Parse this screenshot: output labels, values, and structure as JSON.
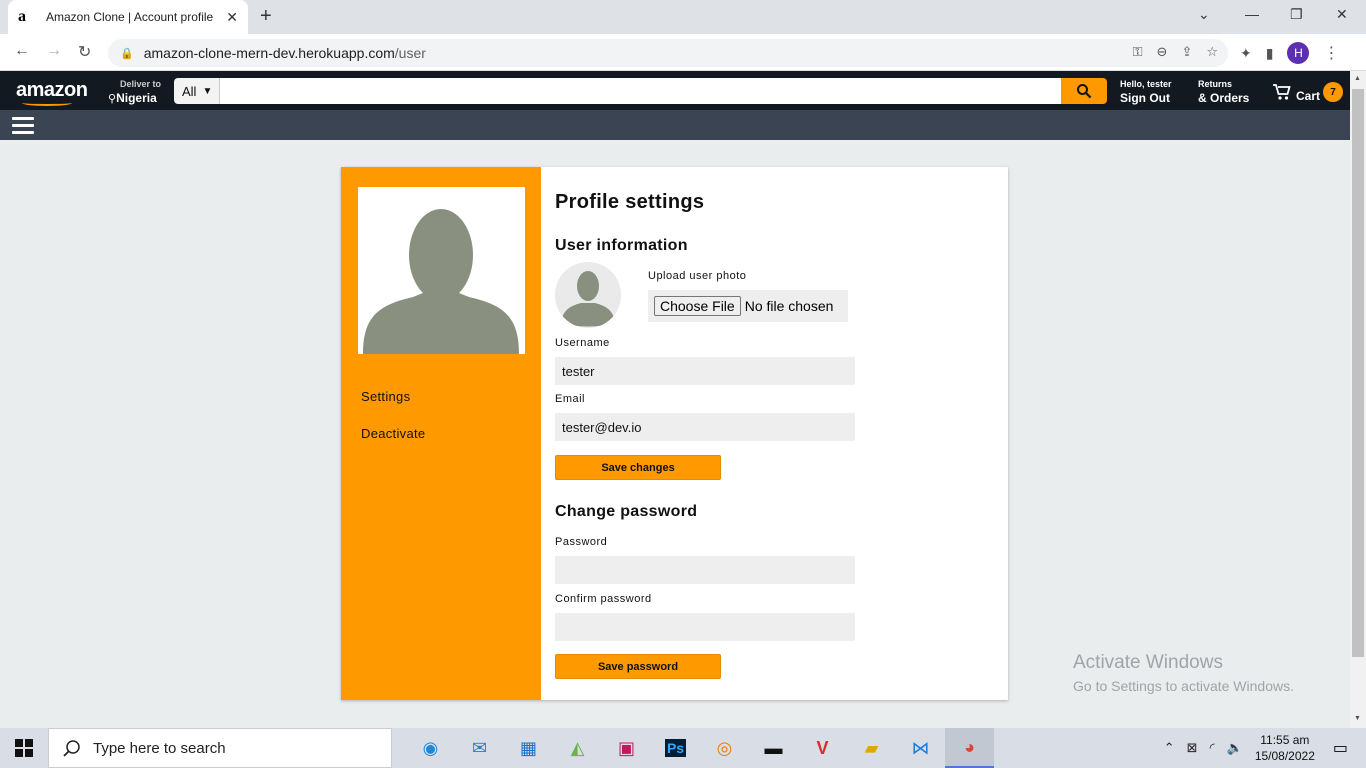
{
  "browser": {
    "tab_title": "Amazon Clone | Account profile",
    "favicon": "a",
    "url_domain": "amazon-clone-mern-dev.herokuapp.com",
    "url_path": "/user",
    "profile_initial": "H"
  },
  "header": {
    "logo": "amazon",
    "deliver_small": "Deliver to",
    "deliver_location": "Nigeria",
    "search_category": "All",
    "search_placeholder": "",
    "greeting": "Hello, tester",
    "sign_out": "Sign Out",
    "returns_small": "Returns",
    "orders": "& Orders",
    "cart_label": "Cart",
    "cart_count": "7"
  },
  "sidebar": {
    "items": [
      {
        "label": "Settings"
      },
      {
        "label": "Deactivate"
      }
    ]
  },
  "profile": {
    "title": "Profile settings",
    "user_info_heading": "User information",
    "upload_label": "Upload user photo",
    "choose_file": "Choose File",
    "no_file": "No file chosen",
    "username_label": "Username",
    "username_value": "tester",
    "email_label": "Email",
    "email_value": "tester@dev.io",
    "save_changes": "Save changes",
    "change_password_heading": "Change password",
    "password_label": "Password",
    "password_value": "",
    "confirm_label": "Confirm password",
    "confirm_value": "",
    "save_password": "Save password"
  },
  "watermark": {
    "line1": "Activate Windows",
    "line2": "Go to Settings to activate Windows."
  },
  "taskbar": {
    "search_text": "Type here to search",
    "time": "11:55 am",
    "date": "15/08/2022"
  },
  "colors": {
    "accent": "#ff9900",
    "header_bg": "#131921",
    "subnav_bg": "#3b4452",
    "avatar_fill": "#8a9080"
  }
}
